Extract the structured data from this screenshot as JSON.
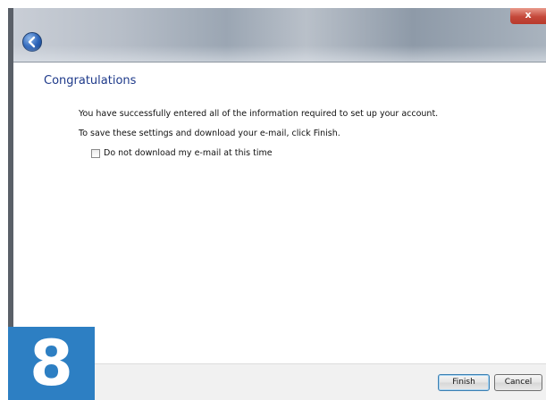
{
  "dialog": {
    "close_label": "x",
    "heading": "Congratulations",
    "message_line_1": "You have successfully entered all of the information required to set up your account.",
    "message_line_2": "To save these settings and download your e-mail, click Finish.",
    "checkbox": {
      "label": "Do not download my e-mail at this time",
      "checked": false
    }
  },
  "footer": {
    "finish_label": "Finish",
    "cancel_label": "Cancel"
  },
  "step_badge": {
    "number": "8"
  },
  "colors": {
    "heading": "#1e3a8a",
    "badge": "#2d7fc3",
    "close_button": "#c4483a"
  },
  "icons": {
    "back": "back-arrow-icon"
  }
}
